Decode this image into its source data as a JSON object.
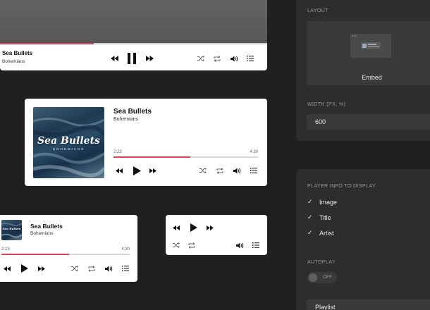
{
  "track": {
    "title": "Sea Bullets",
    "artist": "Bohemians",
    "elapsed": "2:23",
    "duration": "4:30",
    "progress": 0.53
  },
  "cover_art": {
    "title": "Sea Bullets",
    "subtitle": "BOHEMIANS"
  },
  "colors": {
    "accent": "#e0405a",
    "background": "#202020",
    "panel": "#2d2d2d"
  },
  "icons": {
    "previous": "previous-icon",
    "play": "play-icon",
    "pause": "pause-icon",
    "next": "next-icon",
    "shuffle": "shuffle-icon",
    "repeat": "repeat-icon",
    "volume": "volume-icon",
    "playlist": "playlist-icon",
    "check": "check-icon"
  },
  "settings": {
    "layout_label": "LAYOUT",
    "layout_value": "Embed",
    "width_label": "WIDTH (PX, %)",
    "width_value": "600",
    "player_info_label": "PLAYER INFO TO DISPLAY",
    "player_info_options": [
      {
        "label": "Image",
        "checked": true
      },
      {
        "label": "Title",
        "checked": true
      },
      {
        "label": "Artist",
        "checked": true
      }
    ],
    "autoplay_label": "AUTOPLAY",
    "autoplay_value": "OFF",
    "playlist_label": "Playlist"
  }
}
